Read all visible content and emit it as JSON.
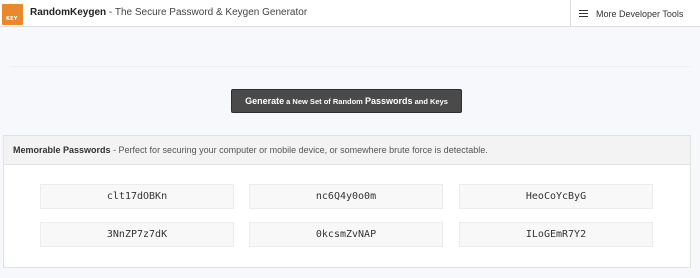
{
  "navbar": {
    "logo_text": "KEY",
    "brand_name": "RandomKeygen",
    "brand_tagline": " - The Secure Password & Keygen Generator",
    "more_tools_label": "More Developer Tools"
  },
  "generate_button": {
    "part1": "Generate",
    "part2": " a New Set of Random ",
    "part3": "Passwords",
    "part4": " and Keys"
  },
  "memorable_section": {
    "title": "Memorable Passwords",
    "description": " - Perfect for securing your computer or mobile device, or somewhere brute force is detectable.",
    "passwords": [
      "clt17dOBKn",
      "nc6Q4y0o0m",
      "HeoCoYcByG",
      "3NnZP7z7dK",
      "0kcsmZvNAP",
      "ILoGEmR7Y2"
    ]
  },
  "colors": {
    "logo": "#e9892d",
    "button": "#4a4a4a",
    "background": "#f7f8fb"
  }
}
